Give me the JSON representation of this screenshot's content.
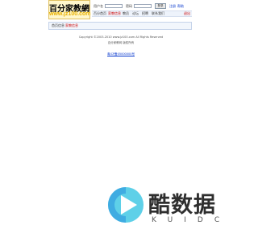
{
  "header": {
    "logo": {
      "cn_text": "百分家教網",
      "en_text": "www.jz100.com"
    },
    "login": {
      "username_label": "用户名",
      "password_label": "密码",
      "login_button": "登录",
      "register_link": "注册",
      "help_link": "帮助"
    },
    "nav": {
      "items": [
        {
          "label": "百分首页"
        },
        {
          "label": "家教信息"
        },
        {
          "label": "教员"
        },
        {
          "label": "论坛"
        },
        {
          "label": "招聘"
        },
        {
          "label": "联系我们"
        }
      ],
      "right_label": "退出"
    }
  },
  "tabs": {
    "items": [
      {
        "label": "首页信息"
      },
      {
        "label": "家教信息"
      }
    ]
  },
  "footer": {
    "copyright": "Copyright ©2003-2010 www.jz100.com All Rights Reserved",
    "sitename": "百分家教网 版权所有",
    "link": "粤ICP备05000000号"
  },
  "watermark": {
    "title": "酷数据",
    "sub": "KUIDC"
  },
  "colors": {
    "accent_red": "#cc0000",
    "link_blue": "#0033cc",
    "logo_yellow": "#e8b000",
    "wm_blue": "#3aa6e0",
    "wm_cyan": "#5ed0e8"
  }
}
